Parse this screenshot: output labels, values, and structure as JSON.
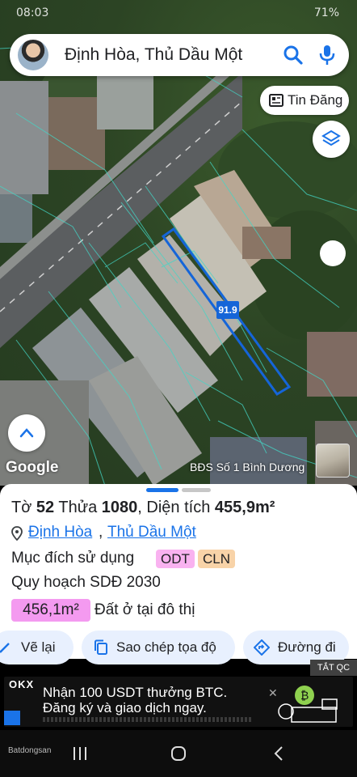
{
  "status_bar": {
    "time": "08:03",
    "battery": "71%"
  },
  "search": {
    "query": "Định Hòa, Thủ Dầu Một"
  },
  "map": {
    "tin_dang_label": "Tin Đăng",
    "dimension_label": "91.9",
    "google_label": "Google",
    "agent_name": "BĐS Số 1 Bình Dương"
  },
  "parcel": {
    "title_prefix": "Tờ",
    "sheet_number": "52",
    "parcel_prefix": "Thửa",
    "parcel_number": "1080",
    "area_prefix": ", Diện tích",
    "area": "455,9m²",
    "ward": "Định Hòa",
    "city": "Thủ Dầu Một",
    "purpose_label": "Mục đích sử dụng",
    "purpose_tags": [
      "ODT",
      "CLN"
    ],
    "plan_label": "Quy hoạch SDĐ 2030",
    "plan_area": "456,1m²",
    "plan_description": "Đất ở tại đô thị"
  },
  "actions": {
    "redraw": "Vẽ lại",
    "copy_coords": "Sao chép tọa độ",
    "route": "Đường đi"
  },
  "ad": {
    "close_label": "TẮT QC",
    "brand": "OKX",
    "line1": "Nhận 100 USDT thưởng BTC.",
    "line2": "Đăng ký và giao dịch ngay."
  },
  "navbar": {
    "watermark": "Batdongsan"
  },
  "colors": {
    "accent": "#1a73e8",
    "tag_odt": "#f9b2f0",
    "tag_cln": "#f8d3a8",
    "area_chip": "#f49af0"
  }
}
